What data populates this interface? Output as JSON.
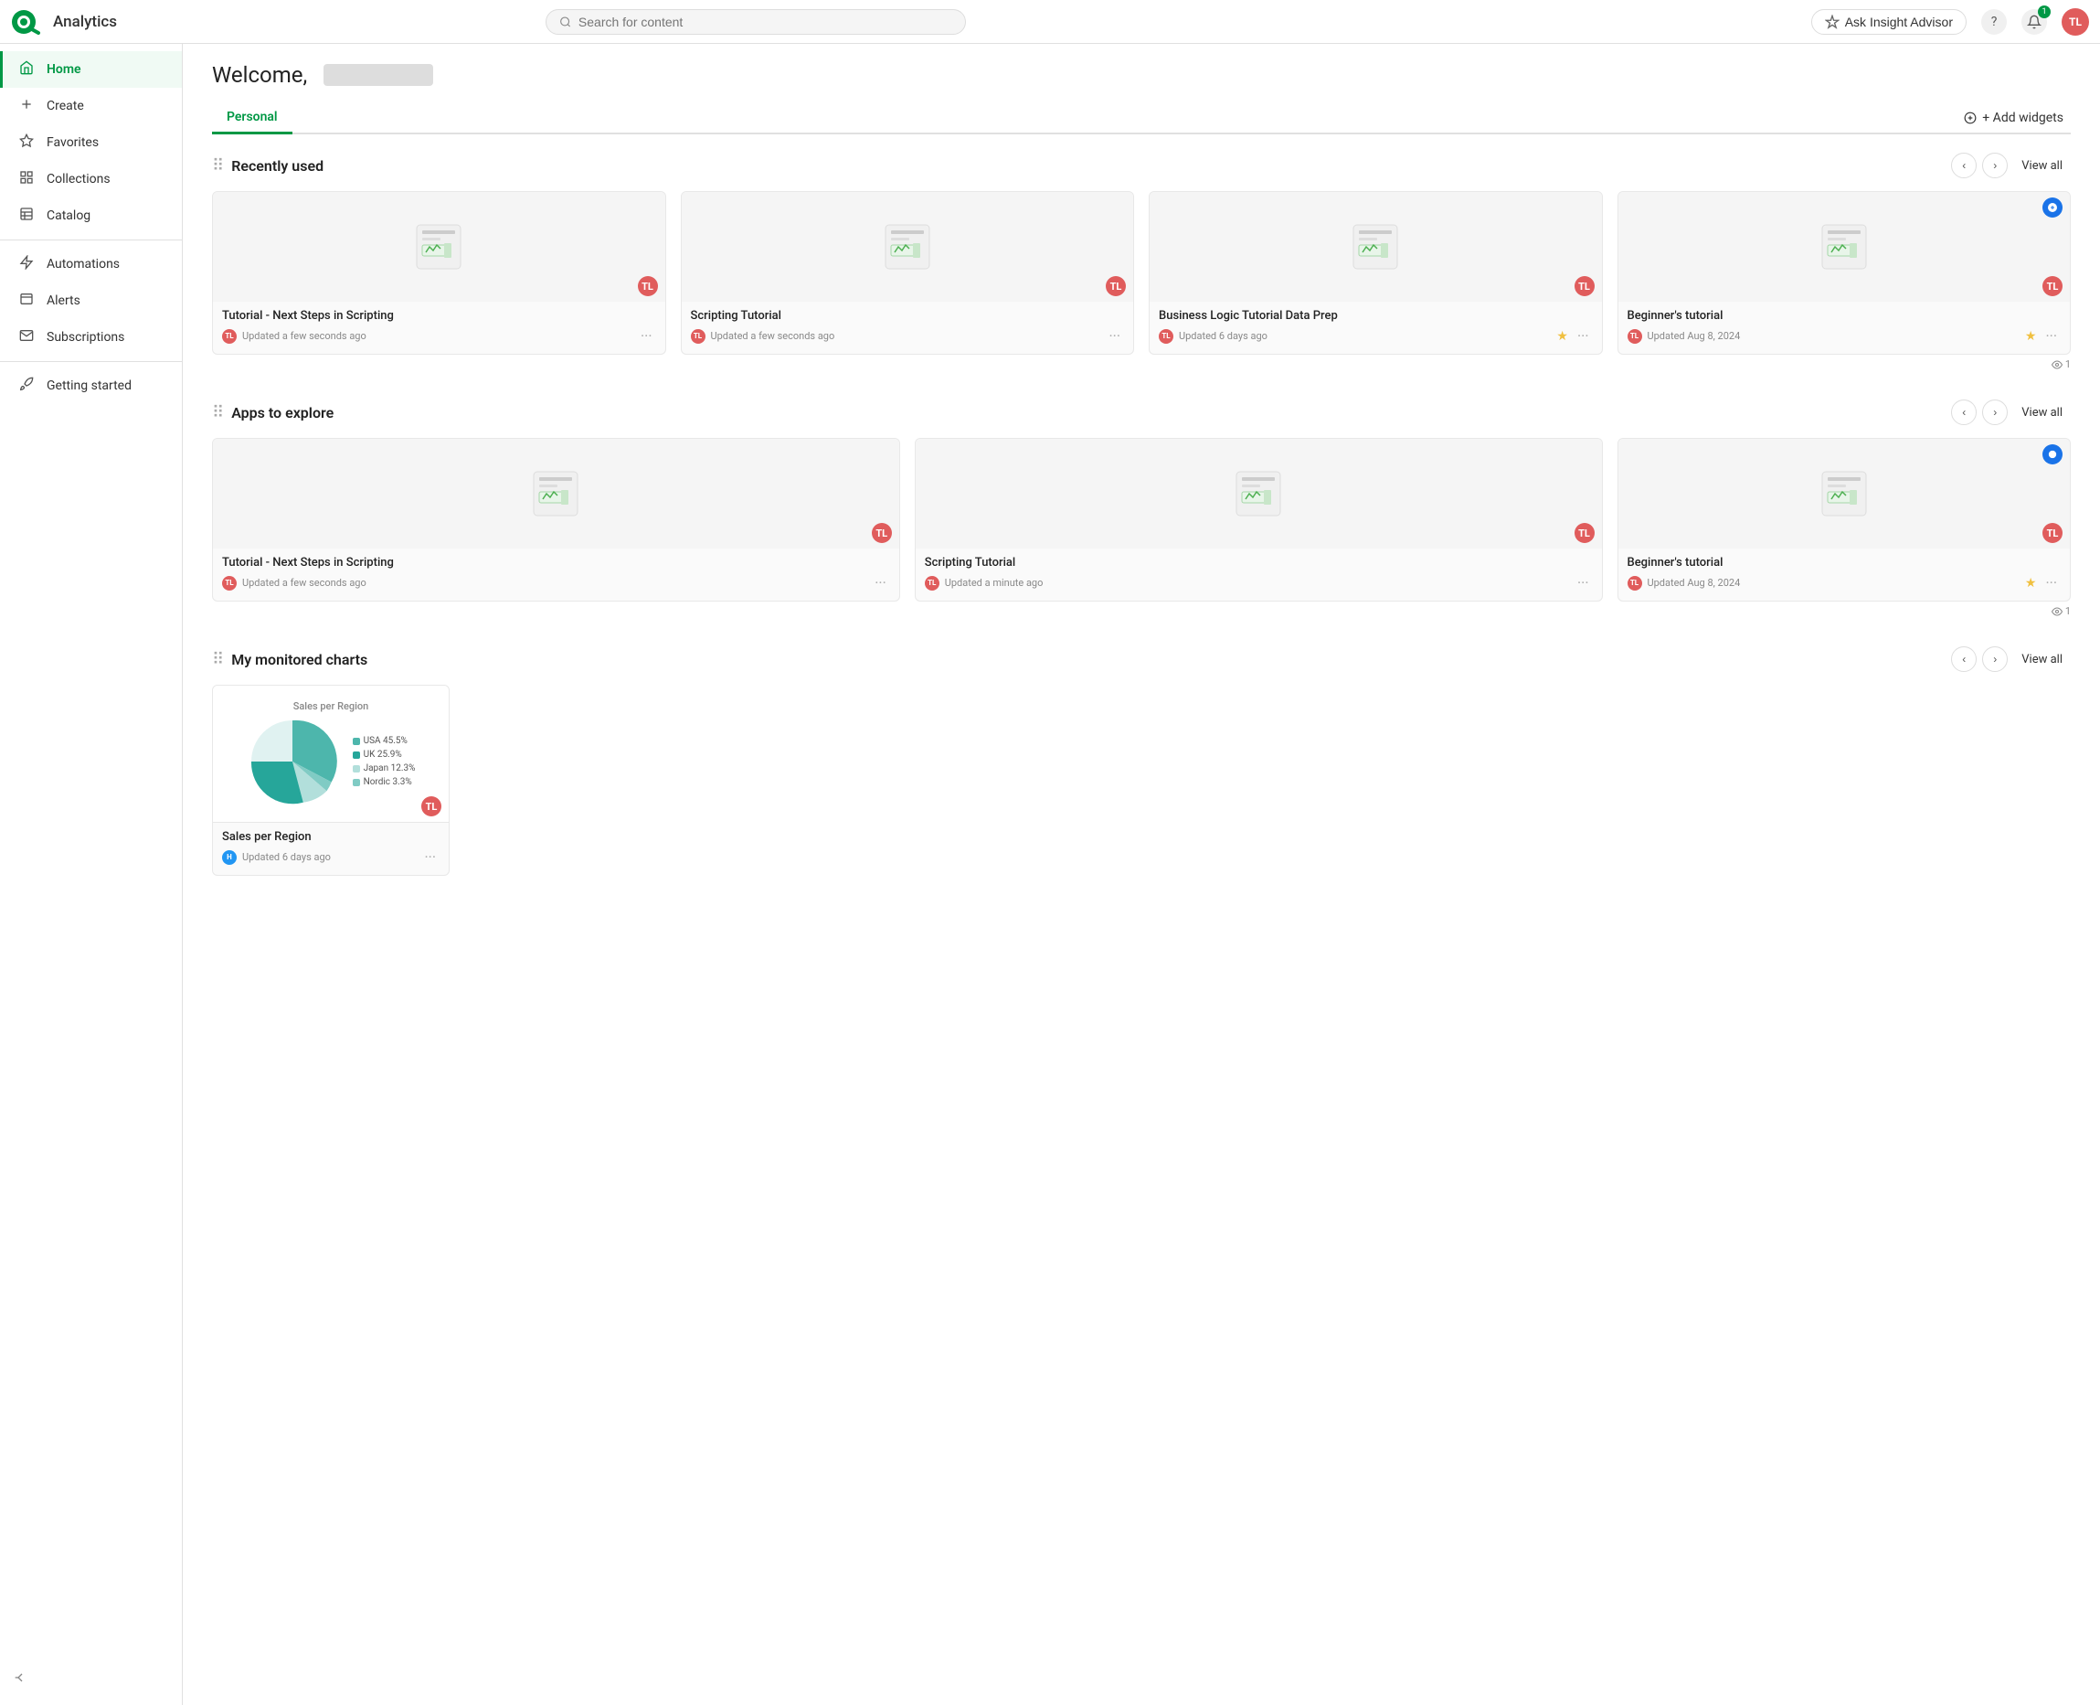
{
  "app_name": "Analytics",
  "topnav": {
    "search_placeholder": "Search for content",
    "insight_advisor_label": "Ask Insight Advisor",
    "help_icon": "?",
    "notification_count": "1",
    "avatar_initials": "TL"
  },
  "sidebar": {
    "items": [
      {
        "id": "home",
        "label": "Home",
        "icon": "⊞",
        "active": true
      },
      {
        "id": "create",
        "label": "Create",
        "icon": "+",
        "active": false
      },
      {
        "id": "favorites",
        "label": "Favorites",
        "icon": "☆",
        "active": false
      },
      {
        "id": "collections",
        "label": "Collections",
        "icon": "▣",
        "active": false
      },
      {
        "id": "catalog",
        "label": "Catalog",
        "icon": "▦",
        "active": false
      },
      {
        "id": "automations",
        "label": "Automations",
        "icon": "⚡",
        "active": false
      },
      {
        "id": "alerts",
        "label": "Alerts",
        "icon": "⊟",
        "active": false
      },
      {
        "id": "subscriptions",
        "label": "Subscriptions",
        "icon": "✉",
        "active": false
      },
      {
        "id": "getting-started",
        "label": "Getting started",
        "icon": "🚀",
        "active": false
      }
    ],
    "collapse_label": "←"
  },
  "main": {
    "welcome_text": "Welcome,",
    "tabs": [
      {
        "id": "personal",
        "label": "Personal",
        "active": true
      }
    ],
    "add_widgets_label": "+ Add widgets",
    "sections": {
      "recently_used": {
        "title": "Recently used",
        "view_all": "View all",
        "cards": [
          {
            "title": "Tutorial - Next Steps in Scripting",
            "updated": "Updated a few seconds ago",
            "avatar_color": "#e05c5c",
            "avatar": "TL",
            "starred": false,
            "action_badge": null
          },
          {
            "title": "Scripting Tutorial",
            "updated": "Updated a few seconds ago",
            "avatar_color": "#e05c5c",
            "avatar": "TL",
            "starred": false,
            "action_badge": null
          },
          {
            "title": "Business Logic Tutorial Data Prep",
            "updated": "Updated 6 days ago",
            "avatar_color": "#e05c5c",
            "avatar": "TL",
            "starred": true,
            "action_badge": null
          },
          {
            "title": "Beginner's tutorial",
            "updated": "Updated Aug 8, 2024",
            "avatar_color": "#e05c5c",
            "avatar": "TL",
            "starred": true,
            "action_badge": "blue"
          }
        ],
        "views": "1"
      },
      "apps_to_explore": {
        "title": "Apps to explore",
        "view_all": "View all",
        "cards": [
          {
            "title": "Tutorial - Next Steps in Scripting",
            "updated": "Updated a few seconds ago",
            "avatar_color": "#e05c5c",
            "avatar": "TL",
            "starred": false,
            "action_badge": null
          },
          {
            "title": "Scripting Tutorial",
            "updated": "Updated a minute ago",
            "avatar_color": "#e05c5c",
            "avatar": "TL",
            "starred": false,
            "action_badge": null
          },
          {
            "title": "Beginner's tutorial",
            "updated": "Updated Aug 8, 2024",
            "avatar_color": "#e05c5c",
            "avatar": "TL",
            "starred": true,
            "action_badge": "blue"
          }
        ],
        "views": "1"
      },
      "my_monitored_charts": {
        "title": "My monitored charts",
        "view_all": "View all",
        "chart": {
          "title": "Sales per Region",
          "updated": "Updated 6 days ago",
          "avatar_color": "#2196F3",
          "avatar": "H",
          "section_title": "Region",
          "legend": [
            {
              "label": "USA",
              "value": "45.5%",
              "color": "#4db6ac"
            },
            {
              "label": "Nordic",
              "value": "3.3%",
              "color": "#80cbc4"
            },
            {
              "label": "Japan",
              "value": "12.3%",
              "color": "#b2dfdb"
            },
            {
              "label": "UK",
              "value": "25.9%",
              "color": "#26a69a"
            }
          ]
        }
      }
    }
  }
}
